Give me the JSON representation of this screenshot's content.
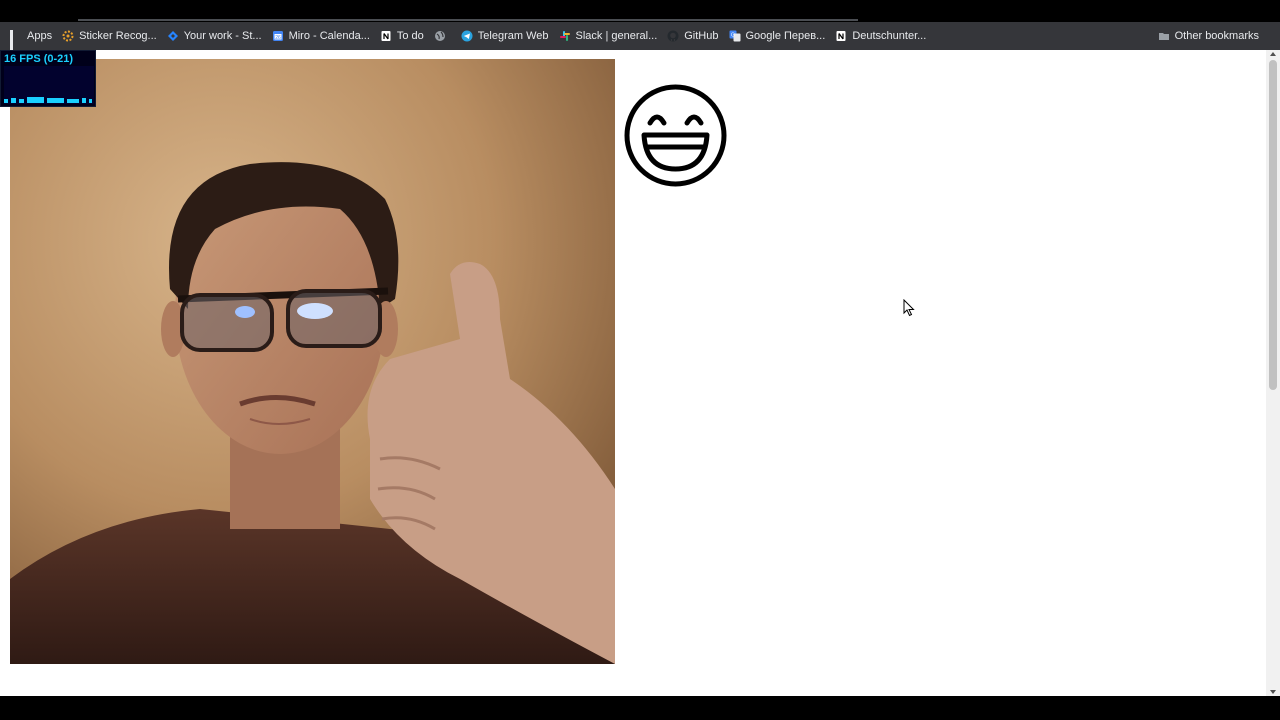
{
  "bookmarks_bar": {
    "items": [
      {
        "label": "Apps",
        "icon": "apps-grid-icon"
      },
      {
        "label": "Sticker Recog...",
        "icon": "gear-icon"
      },
      {
        "label": "Your work - St...",
        "icon": "jira-icon"
      },
      {
        "label": "Miro - Calenda...",
        "icon": "calendar-icon"
      },
      {
        "label": "To do",
        "icon": "notion-icon"
      },
      {
        "label": "",
        "icon": "globe-icon"
      },
      {
        "label": "Telegram Web",
        "icon": "telegram-icon"
      },
      {
        "label": "Slack | general...",
        "icon": "slack-icon"
      },
      {
        "label": "GitHub",
        "icon": "github-icon"
      },
      {
        "label": "Google Перев...",
        "icon": "google-translate-icon"
      },
      {
        "label": "Deutschunter...",
        "icon": "notion-icon"
      }
    ],
    "other_bookmarks": {
      "label": "Other bookmarks",
      "icon": "folder-icon"
    }
  },
  "fps_meter": {
    "text": "16 FPS (0-21)",
    "color": "#1ad0ff"
  },
  "webcam": {
    "description_icon": "webcam-video"
  },
  "emoji": {
    "icon": "grinning-face-icon"
  },
  "colors": {
    "bookmarks_bg": "#35363a",
    "bookmarks_text": "#e8eaed",
    "page_bg": "#ffffff"
  }
}
